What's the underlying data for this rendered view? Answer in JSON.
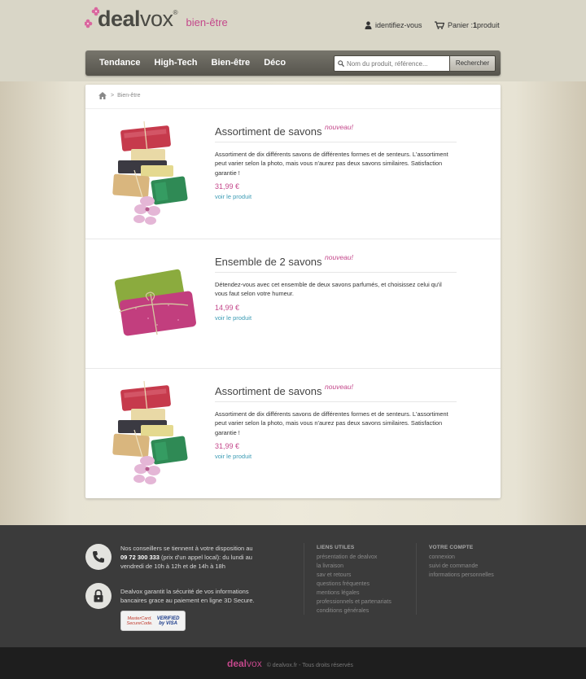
{
  "header": {
    "logo_deal": "deal",
    "logo_vox": "vox",
    "logo_reg": "®",
    "logo_tagline": "bien-être",
    "login_label": "identifiez-vous",
    "cart_prefix": "Panier : ",
    "cart_count": "1",
    "cart_suffix": " produit"
  },
  "nav": {
    "items": [
      "Tendance",
      "High-Tech",
      "Bien-être",
      "Déco"
    ],
    "search_placeholder": "Nom du produit, référence...",
    "search_button": "Rechercher"
  },
  "breadcrumb": {
    "separator": ">",
    "current": "Bien-être"
  },
  "products": [
    {
      "title": "Assortiment de savons",
      "badge": "nouveau!",
      "description": "Assortiment de dix différents savons de différentes formes et de senteurs. L'assortiment peut varier selon la photo, mais vous n'aurez pas deux savons similaires. Satisfaction garantie !",
      "price": "31,99 €",
      "link": "voir le produit",
      "image": "soap-stack-image"
    },
    {
      "title": "Ensemble de 2 savons",
      "badge": "nouveau!",
      "description": "Détendez-vous avec cet ensemble de deux savons parfumés, et choisissez celui qu'il vous faut selon votre humeur.",
      "price": "14,99 €",
      "link": "voir le produit",
      "image": "soap-pair-image"
    },
    {
      "title": "Assortiment de savons",
      "badge": "nouveau!",
      "description": "Assortiment de dix différents savons de différentes formes et de senteurs. L'assortiment peut varier selon la photo, mais vous n'aurez pas deux savons similaires. Satisfaction garantie !",
      "price": "31,99 €",
      "link": "voir le produit",
      "image": "soap-stack-image"
    }
  ],
  "footer": {
    "support_line1": "Nos conseillers se tiennent à votre disposition au",
    "support_phone": "09 72 300 333",
    "support_line2_rest": " (prix d'un appel local): du lundi au",
    "support_line3": "vendredi de 10h à 12h et de 14h à 18h",
    "security_line1": "Dealvox garantit la sécurité de vos informations",
    "security_line2": "bancaires grace au paiement en ligne 3D Secure.",
    "card1_line1": "MasterCard.",
    "card1_line2": "SecureCode.",
    "card2_line1": "VERIFIED",
    "card2_line2": "by VISA",
    "useful_title": "LIENS UTILES",
    "useful_links": [
      "présentation de dealvox",
      "la livraison",
      "sav et retours",
      "questions fréquentes",
      "mentions légales",
      "professionnels et partenariats",
      "conditions générales"
    ],
    "account_title": "VOTRE COMPTE",
    "account_links": [
      "connexion",
      "suivi de commande",
      "informations personnelles"
    ]
  },
  "bottom": {
    "logo_deal": "deal",
    "logo_vox": "vox",
    "copyright": "© dealvox.fr - Tous droits réservés"
  },
  "colors": {
    "accent": "#c4488b",
    "link": "#3b9bb4",
    "nav_bg": "#67655c",
    "footer_bg": "#3b3b3b",
    "bottom_bg": "#1e1e1e"
  }
}
